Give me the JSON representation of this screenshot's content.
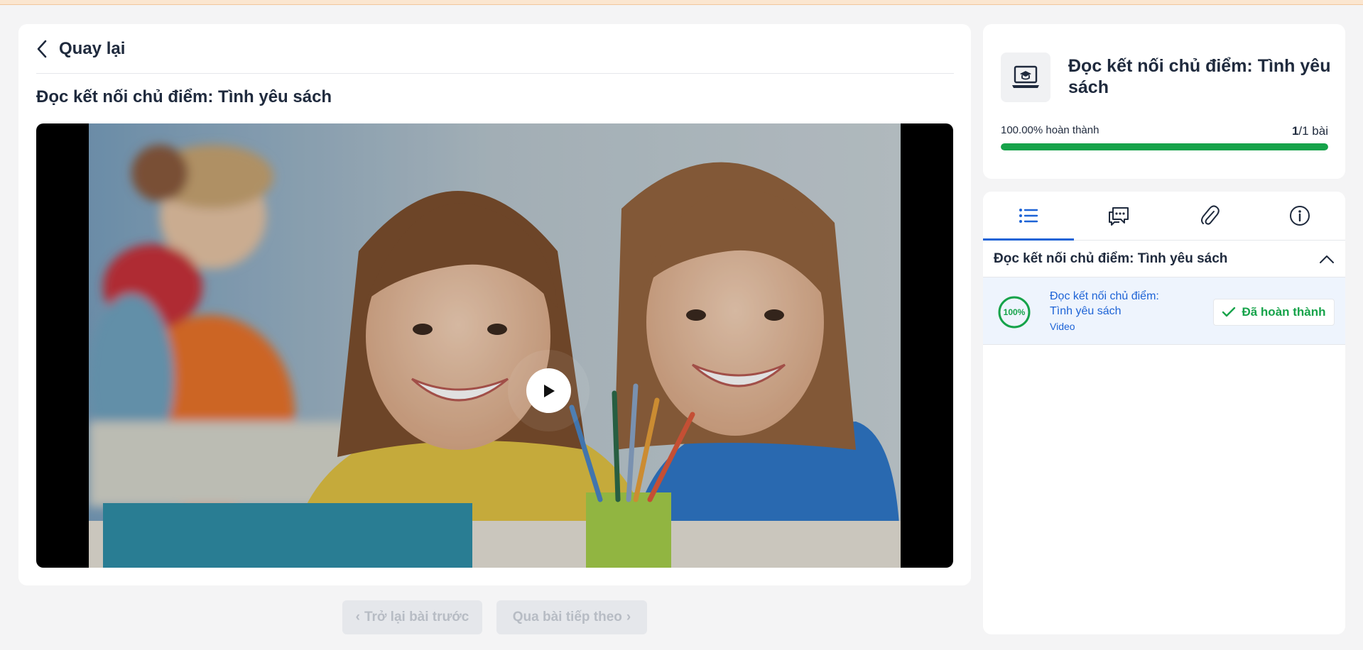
{
  "main": {
    "back_label": "Quay lại",
    "lesson_title": "Đọc kết nối chủ điểm: Tình yêu sách",
    "prev_button": "Trở lại bài trước",
    "next_button": "Qua bài tiếp theo"
  },
  "summary": {
    "course_title": "Đọc kết nối chủ điểm: Tình yêu sách",
    "progress_text": "100.00% hoàn thành",
    "progress_fraction": 1.0,
    "done_count": "1",
    "total_count": "/1 bài"
  },
  "tabs": [
    {
      "name": "list-icon",
      "active": true
    },
    {
      "name": "comments-icon",
      "active": false
    },
    {
      "name": "attachment-icon",
      "active": false
    },
    {
      "name": "info-icon",
      "active": false
    }
  ],
  "section": {
    "title": "Đọc kết nối chủ điểm: Tình yêu sách"
  },
  "lesson_item": {
    "percent": "100%",
    "title": "Đọc kết nối chủ điểm: Tình yêu sách",
    "type": "Video",
    "status": "Đã hoàn thành"
  },
  "colors": {
    "accent": "#1d63d6",
    "success": "#16a34a",
    "text": "#1f2a3d"
  }
}
